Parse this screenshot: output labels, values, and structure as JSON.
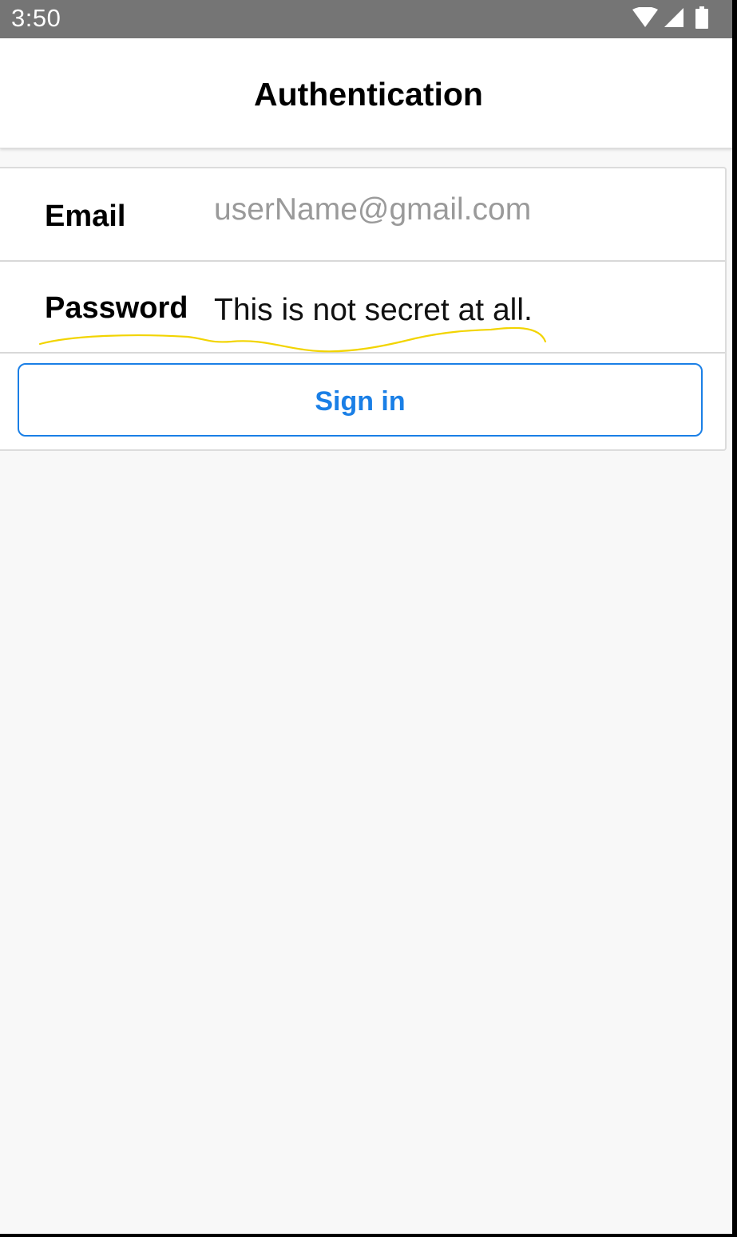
{
  "status_bar": {
    "time": "3:50",
    "icons": [
      "wifi-icon",
      "cellular-signal-icon",
      "battery-icon"
    ]
  },
  "header": {
    "title": "Authentication"
  },
  "form": {
    "email": {
      "label": "Email",
      "value": "",
      "placeholder": "userName@gmail.com"
    },
    "password": {
      "label": "Password",
      "value": "This is not secret at all.",
      "placeholder": ""
    },
    "submit_label": "Sign in"
  },
  "colors": {
    "accent": "#1a7fe6",
    "status_bar": "#757575",
    "annotation": "#f2d400"
  }
}
